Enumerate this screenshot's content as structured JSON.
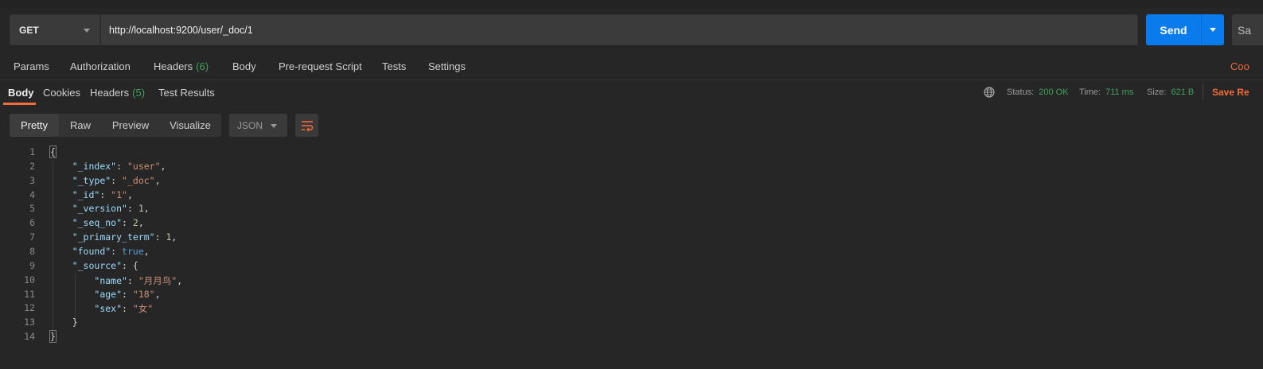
{
  "request": {
    "method": "GET",
    "url": "http://localhost:9200/user/_doc/1",
    "send_label": "Send",
    "save_label": "Sa"
  },
  "request_tabs": [
    {
      "label": "Params",
      "count": ""
    },
    {
      "label": "Authorization",
      "count": ""
    },
    {
      "label": "Headers",
      "count": "(6)"
    },
    {
      "label": "Body",
      "count": ""
    },
    {
      "label": "Pre-request Script",
      "count": ""
    },
    {
      "label": "Tests",
      "count": ""
    },
    {
      "label": "Settings",
      "count": ""
    }
  ],
  "request_right_link": "Coo",
  "response_tabs": [
    {
      "label": "Body",
      "count": ""
    },
    {
      "label": "Cookies",
      "count": ""
    },
    {
      "label": "Headers",
      "count": "(5)"
    },
    {
      "label": "Test Results",
      "count": ""
    }
  ],
  "response_status": {
    "status_label": "Status:",
    "status_value": "200 OK",
    "time_label": "Time:",
    "time_value": "711 ms",
    "size_label": "Size:",
    "size_value": "621 B",
    "save_response": "Save Re"
  },
  "view_modes": [
    "Pretty",
    "Raw",
    "Preview",
    "Visualize"
  ],
  "active_view": "Pretty",
  "format": "JSON",
  "code_lines": [
    {
      "n": "1",
      "text": "{"
    },
    {
      "n": "2",
      "text": "    \"_index\": \"user\","
    },
    {
      "n": "3",
      "text": "    \"_type\": \"_doc\","
    },
    {
      "n": "4",
      "text": "    \"_id\": \"1\","
    },
    {
      "n": "5",
      "text": "    \"_version\": 1,"
    },
    {
      "n": "6",
      "text": "    \"_seq_no\": 2,"
    },
    {
      "n": "7",
      "text": "    \"_primary_term\": 1,"
    },
    {
      "n": "8",
      "text": "    \"found\": true,"
    },
    {
      "n": "9",
      "text": "    \"_source\": {"
    },
    {
      "n": "10",
      "text": "        \"name\": \"月月鸟\","
    },
    {
      "n": "11",
      "text": "        \"age\": \"18\","
    },
    {
      "n": "12",
      "text": "        \"sex\": \"女\""
    },
    {
      "n": "13",
      "text": "    }"
    },
    {
      "n": "14",
      "text": "}"
    }
  ],
  "colors": {
    "accent": "#f26b3a",
    "send": "#097bed",
    "status_ok": "#3fa35b"
  }
}
